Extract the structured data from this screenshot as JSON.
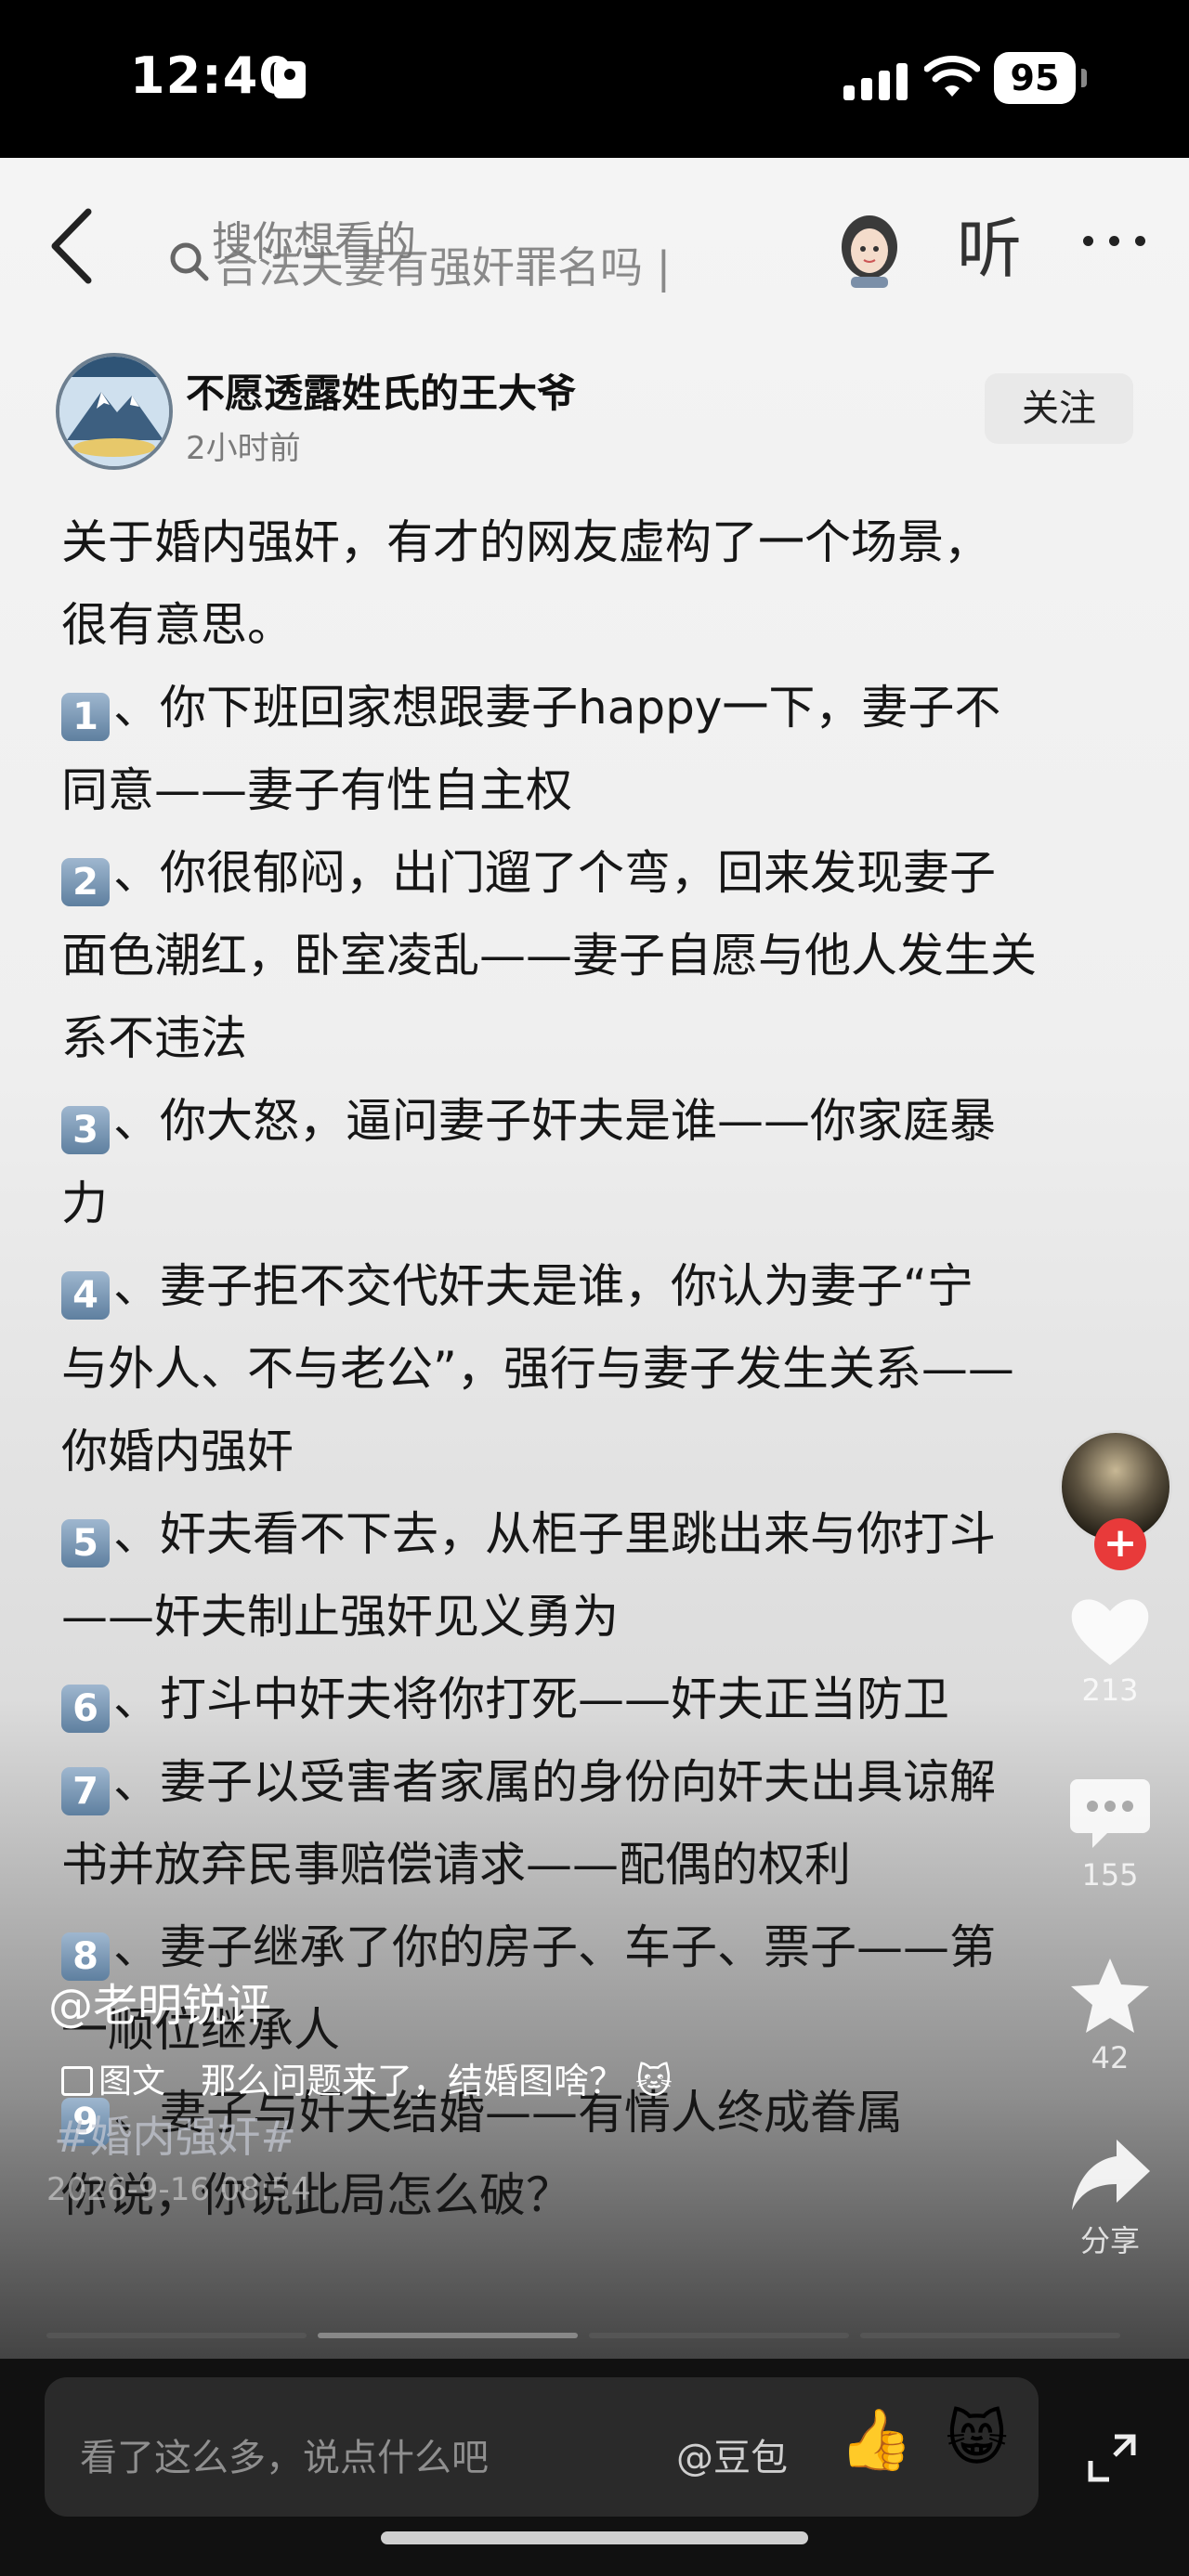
{
  "status_bar": {
    "time": "12:40",
    "battery": "95"
  },
  "topnav": {
    "search_placeholder": "搜你想看的",
    "search_query": "合法夫妻有强奸罪名吗 |",
    "listen_label": "听"
  },
  "author": {
    "name": "不愿透露姓氏的王大爷",
    "time": "2小时前",
    "follow_label": "关注"
  },
  "post": {
    "lines": [
      {
        "num": "",
        "text": "关于婚内强奸，有才的网友虚构了一个场景，"
      },
      {
        "num": "",
        "text": "很有意思。"
      },
      {
        "num": "1",
        "text": "、你下班回家想跟妻子happy一下，妻子不"
      },
      {
        "num": "",
        "text": "同意——妻子有性自主权"
      },
      {
        "num": "2",
        "text": "、你很郁闷，出门遛了个弯，回来发现妻子"
      },
      {
        "num": "",
        "text": "面色潮红，卧室凌乱——妻子自愿与他人发生关"
      },
      {
        "num": "",
        "text": "系不违法"
      },
      {
        "num": "3",
        "text": "、你大怒，逼问妻子奸夫是谁——你家庭暴"
      },
      {
        "num": "",
        "text": "力"
      },
      {
        "num": "4",
        "text": "、妻子拒不交代奸夫是谁，你认为妻子“宁"
      },
      {
        "num": "",
        "text": "与外人、不与老公”，强行与妻子发生关系——"
      },
      {
        "num": "",
        "text": "你婚内强奸"
      },
      {
        "num": "5",
        "text": "、奸夫看不下去，从柜子里跳出来与你打斗"
      },
      {
        "num": "",
        "text": "——奸夫制止强奸见义勇为"
      },
      {
        "num": "6",
        "text": "、打斗中奸夫将你打死——奸夫正当防卫"
      },
      {
        "num": "7",
        "text": "、妻子以受害者家属的身份向奸夫出具谅解"
      },
      {
        "num": "",
        "text": "书并放弃民事赔偿请求——配偶的权利"
      },
      {
        "num": "8",
        "text": "、妻子继承了你的房子、车子、票子——第"
      },
      {
        "num": "",
        "text": "一顺位继承人"
      },
      {
        "num": "9",
        "text": "、妻子与奸夫结婚——有情人终成眷属"
      },
      {
        "num": "",
        "text": "你说，你说此局怎么破？"
      }
    ]
  },
  "actions": {
    "likes": "213",
    "comments": "155",
    "favorites": "42",
    "share_label": "分享"
  },
  "caption": {
    "user": "@老明锐评",
    "type_label": "图文",
    "text": "那么问题来了，结婚图啥？ 🐱",
    "hashtag": "#婚内强奸#",
    "date": "2026-9-16 08:54"
  },
  "comment_bar": {
    "placeholder": "看了这么多，说点什么吧",
    "mention": "@豆包"
  },
  "icons": {
    "back": "chevron-left-icon",
    "search": "search-icon",
    "more": "more-dots-icon",
    "like": "heart-icon",
    "comment": "comment-icon",
    "favorite": "star-icon",
    "share": "share-arrow-icon",
    "expand": "expand-icon"
  }
}
